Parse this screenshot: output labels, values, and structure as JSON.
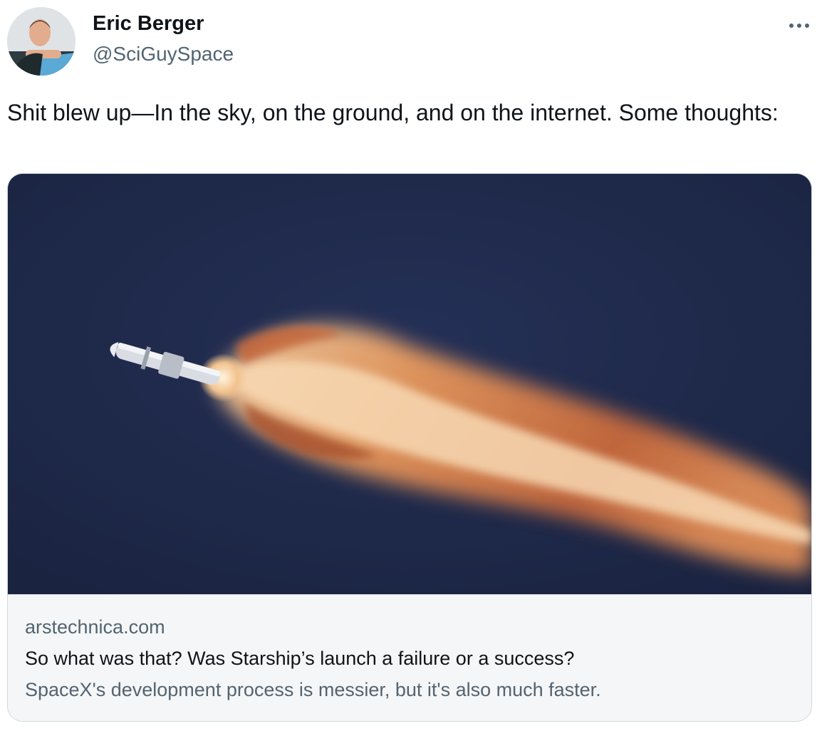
{
  "tweet": {
    "author": {
      "name": "Eric Berger",
      "handle": "@SciGuySpace",
      "avatar_icon": "profile-photo"
    },
    "more_icon": "more-horizontal-icon",
    "text": "Shit blew up—In the sky, on the ground, and on the internet. Some thoughts:",
    "card": {
      "image_description_icon": "rocket-launch-photo",
      "domain": "arstechnica.com",
      "title": "So what was that? Was Starship’s launch a failure or a success?",
      "description": "SpaceX's development process is messier, but it's also much faster."
    }
  },
  "colors": {
    "text_primary": "#0f1419",
    "text_secondary": "#536471",
    "border": "#cfd9de",
    "sky": "#1d2745",
    "exhaust": "#e8955a"
  }
}
